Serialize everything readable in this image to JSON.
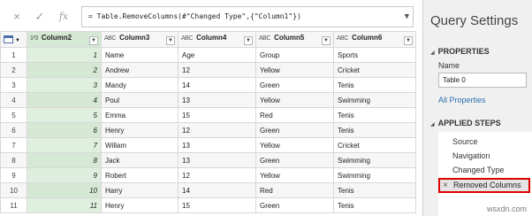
{
  "formula_bar": {
    "cancel_icon": "×",
    "confirm_icon": "✓",
    "fx_label": "fx",
    "formula": "= Table.RemoveColumns(#\"Changed Type\",{\"Column1\"})",
    "expand_icon": "chevron-down-icon"
  },
  "grid": {
    "columns": [
      {
        "type": "1²3",
        "name": "Column2"
      },
      {
        "type": "ABC",
        "name": "Column3"
      },
      {
        "type": "ABC",
        "name": "Column4"
      },
      {
        "type": "ABC",
        "name": "Column5"
      },
      {
        "type": "ABC",
        "name": "Column6"
      }
    ],
    "rows": [
      [
        "1",
        "1",
        "Name",
        "Age",
        "Group",
        "Sports"
      ],
      [
        "2",
        "2",
        "Andrew",
        "12",
        "Yellow",
        "Cricket"
      ],
      [
        "3",
        "3",
        "Mandy",
        "14",
        "Green",
        "Tenis"
      ],
      [
        "4",
        "4",
        "Poul",
        "13",
        "Yellow",
        "Swimming"
      ],
      [
        "5",
        "5",
        "Emma",
        "15",
        "Red",
        "Tenis"
      ],
      [
        "6",
        "6",
        "Henry",
        "12",
        "Green",
        "Tenis"
      ],
      [
        "7",
        "7",
        "Willam",
        "13",
        "Yellow",
        "Cricket"
      ],
      [
        "8",
        "8",
        "Jack",
        "13",
        "Green",
        "Swimming"
      ],
      [
        "9",
        "9",
        "Robert",
        "12",
        "Yellow",
        "Swimming"
      ],
      [
        "10",
        "10",
        "Harry",
        "14",
        "Red",
        "Tenis"
      ],
      [
        "11",
        "11",
        "Henry",
        "15",
        "Green",
        "Tenis"
      ]
    ]
  },
  "query_settings": {
    "title": "Query Settings",
    "properties_heading": "PROPERTIES",
    "name_label": "Name",
    "name_value": "Table 0",
    "all_properties_link": "All Properties",
    "applied_steps_heading": "APPLIED STEPS",
    "steps": [
      "Source",
      "Navigation",
      "Changed Type",
      "Removed Columns"
    ],
    "active_step_icon": "×"
  },
  "watermark": "wsxdn.com",
  "colors": {
    "selected_column": "#d4e8d4",
    "active_step_border": "#e00000",
    "link": "#2e6fb0"
  }
}
